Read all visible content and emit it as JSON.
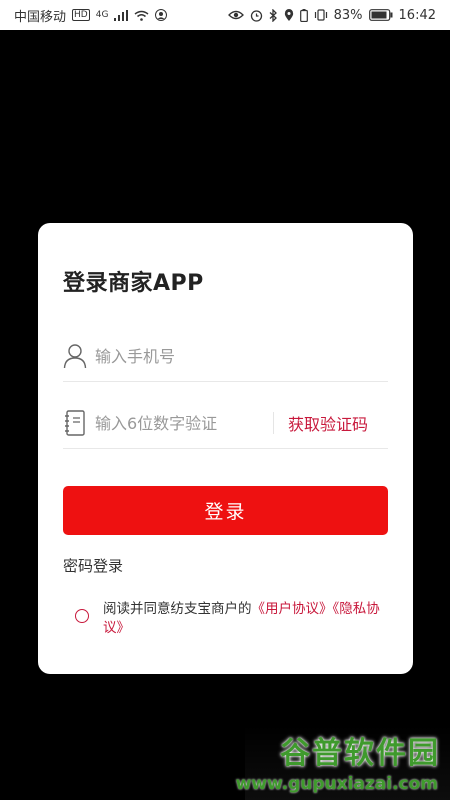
{
  "status_bar": {
    "carrier": "中国移动",
    "hd_badge": "HD",
    "network": "4G",
    "battery_percent": "83%",
    "time": "16:42"
  },
  "login": {
    "title": "登录商家APP",
    "phone_placeholder": "输入手机号",
    "code_placeholder": "输入6位数字验证",
    "get_code_label": "获取验证码",
    "login_button_label": "登录",
    "password_login_label": "密码登录",
    "agreement_prefix": "阅读并同意纺支宝商户的",
    "user_agreement_link": "《用户协议》",
    "privacy_link": "《隐私协议》"
  },
  "watermark": {
    "title": "谷普软件园",
    "url": "www.gupuxiazai.com"
  },
  "colors": {
    "accent_red": "#ee1111",
    "link_red": "#c8193c",
    "watermark_green": "#3f9a2d"
  }
}
